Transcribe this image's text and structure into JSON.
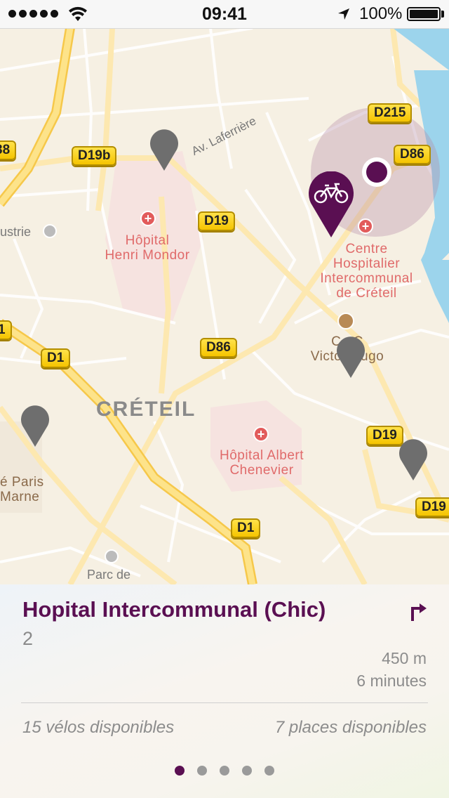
{
  "status_bar": {
    "time": "09:41",
    "battery_pct": "100%"
  },
  "map": {
    "road_labels": [
      "D215",
      "D86",
      "D19b",
      "D19",
      "D86",
      "D1",
      "D19",
      "D19",
      "D1",
      "38",
      "1"
    ],
    "places": {
      "hospital_mondor": "Hôpital\nHenri Mondor",
      "chic": "Centre\nHospitalier\nIntercommunal\nde Créteil",
      "albert": "Hôpital Albert\nChenevier",
      "victor_hugo": "C   C\nVictor Hugo",
      "city": "CRÉTEIL",
      "street": "Av. Laferrière",
      "industrie": "ustrie",
      "parc": "Parc de",
      "paris_marne": "é Paris\nMarne"
    },
    "selected_color": "#5a0f52",
    "pin_color": "#6e6e6e"
  },
  "station": {
    "name": "Hopital Intercommunal (Chic)",
    "number": "2",
    "distance": "450 m",
    "duration": "6 minutes",
    "bikes": "15 vélos disponibles",
    "places": "7 places disponibles"
  },
  "pager": {
    "count": 5,
    "active": 0
  }
}
